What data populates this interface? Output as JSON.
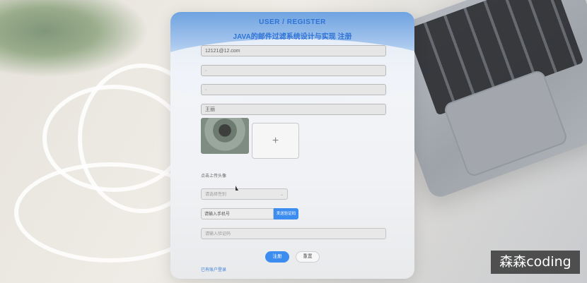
{
  "header": {
    "title_en": "USER / REGISTER",
    "title_cn": "JAVA的邮件过滤系统设计与实现 注册"
  },
  "form": {
    "email_value": "12121@12.com",
    "password_value": "·",
    "confirm_password_value": "·",
    "nickname_value": "王丽",
    "upload_add_symbol": "+",
    "avatar_hint": "点击上传头像",
    "gender_placeholder": "请选择性别",
    "gender_chevron": "⌄",
    "phone_placeholder": "请输入手机号",
    "send_code_label": "发送验证码",
    "code_placeholder": "请输入验证码",
    "register_label": "注册",
    "reset_label": "重置",
    "login_link": "已有账户登录"
  },
  "watermark": {
    "text": "森森coding"
  },
  "colors": {
    "accent": "#3d8cf0",
    "title": "#2e73d6"
  }
}
